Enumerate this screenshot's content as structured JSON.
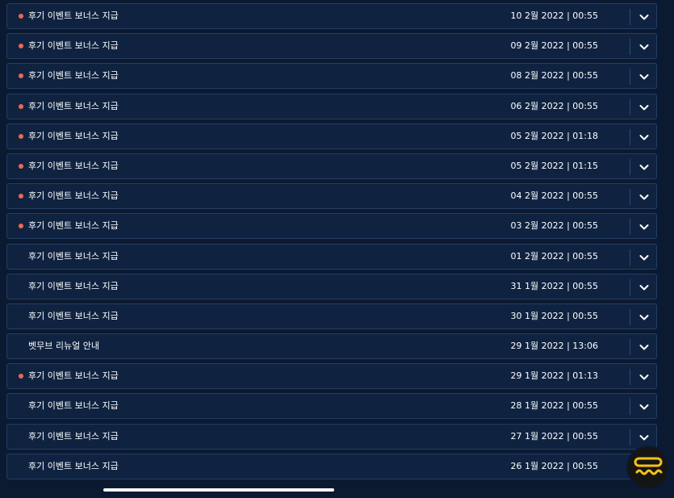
{
  "colors": {
    "unread_dot": "#f0684f",
    "row_background": "#0f2341",
    "row_border": "#223d62",
    "page_background": "#0b1a31",
    "fab_accent": "#f2c21b"
  },
  "icons": {
    "row_toggle": "chevron-down-icon",
    "fab": "chat-icon"
  },
  "notifications": [
    {
      "title": "후기 이벤트 보너스 지급",
      "date": "10 2월 2022 | 00:55",
      "unread": true
    },
    {
      "title": "후기 이벤트 보너스 지급",
      "date": "09 2월 2022 | 00:55",
      "unread": true
    },
    {
      "title": "후기 이벤트 보너스 지급",
      "date": "08 2월 2022 | 00:55",
      "unread": true
    },
    {
      "title": "후기 이벤트 보너스 지급",
      "date": "06 2월 2022 | 00:55",
      "unread": true
    },
    {
      "title": "후기 이벤트 보너스 지급",
      "date": "05 2월 2022 | 01:18",
      "unread": true
    },
    {
      "title": "후기 이벤트 보너스 지급",
      "date": "05 2월 2022 | 01:15",
      "unread": true
    },
    {
      "title": "후기 이벤트 보너스 지급",
      "date": "04 2월 2022 | 00:55",
      "unread": true
    },
    {
      "title": "후기 이벤트 보너스 지급",
      "date": "03 2월 2022 | 00:55",
      "unread": true
    },
    {
      "title": "후기 이벤트 보너스 지급",
      "date": "01 2월 2022 | 00:55",
      "unread": false
    },
    {
      "title": "후기 이벤트 보너스 지급",
      "date": "31 1월 2022 | 00:55",
      "unread": false
    },
    {
      "title": "후기 이벤트 보너스 지급",
      "date": "30 1월 2022 | 00:55",
      "unread": false
    },
    {
      "title": "벳무브 리뉴얼 안내",
      "date": "29 1월 2022 | 13:06",
      "unread": false
    },
    {
      "title": "후기 이벤트 보너스 지급",
      "date": "29 1월 2022 | 01:13",
      "unread": true
    },
    {
      "title": "후기 이벤트 보너스 지급",
      "date": "28 1월 2022 | 00:55",
      "unread": false
    },
    {
      "title": "후기 이벤트 보너스 지급",
      "date": "27 1월 2022 | 00:55",
      "unread": false
    },
    {
      "title": "후기 이벤트 보너스 지급",
      "date": "26 1월 2022 | 00:55",
      "unread": false
    }
  ]
}
